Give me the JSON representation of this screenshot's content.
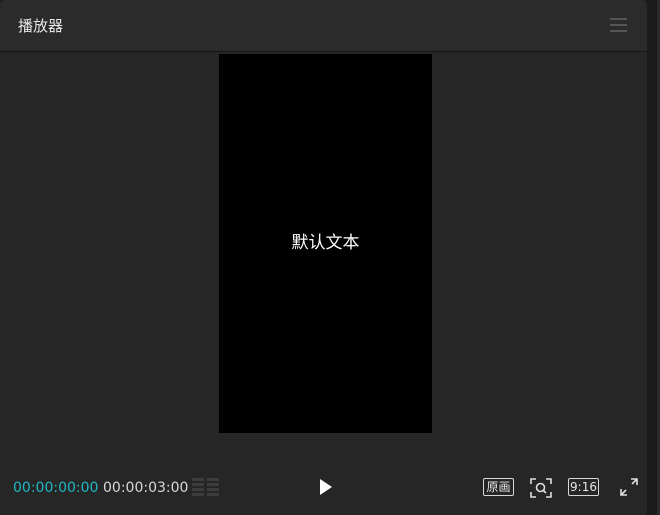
{
  "panel": {
    "title": "播放器",
    "menu_icon": "hamburger-menu-icon"
  },
  "preview": {
    "overlay_text": "默认文本",
    "background": "#000000"
  },
  "controls": {
    "current_time": "00:00:00:00",
    "total_time": "00:00:03:00",
    "current_time_color": "#20b8c4",
    "original_label": "原画",
    "aspect_label": "9:16",
    "icons": {
      "timeline_grid": "grid-icon",
      "play": "play-icon",
      "zoom_fit": "zoom-fit-icon",
      "fullscreen": "fullscreen-icon"
    }
  }
}
